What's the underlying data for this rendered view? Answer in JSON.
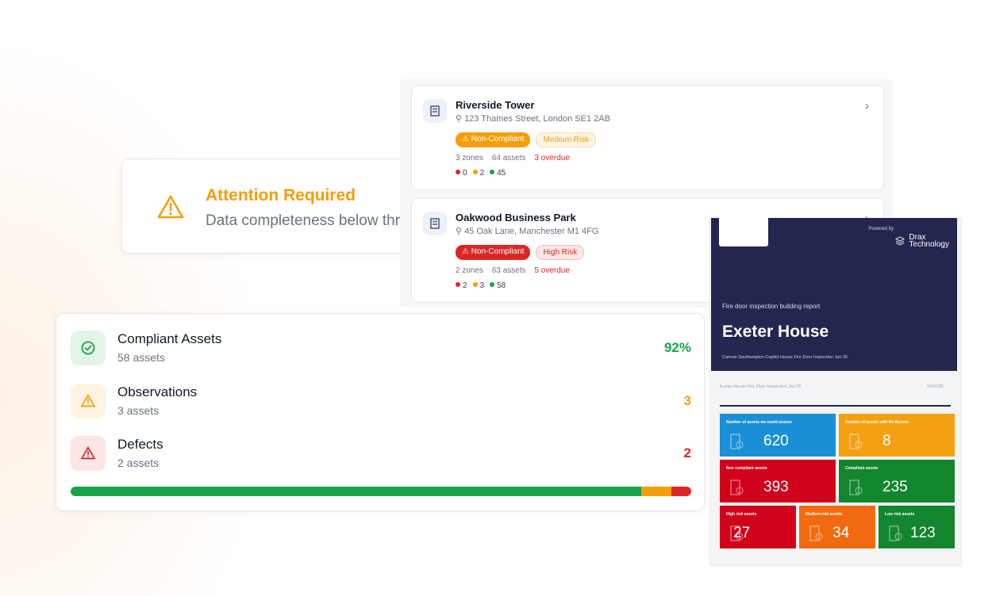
{
  "attention": {
    "title": "Attention Required",
    "text": "Data completeness below threshold"
  },
  "properties": [
    {
      "name": "Riverside Tower",
      "address": "123 Thames Street, London SE1 2AB",
      "compliance_label": "Non-Compliant",
      "compliance_color": "#f59e0b",
      "risk_label": "Medium Risk",
      "zones": "3 zones",
      "assets": "64 assets",
      "overdue": "3 overdue",
      "counts": {
        "red": "0",
        "amber": "2",
        "green": "45"
      }
    },
    {
      "name": "Oakwood Business Park",
      "address": "45 Oak Lane, Manchester M1 4FG",
      "compliance_label": "Non-Compliant",
      "compliance_color": "#dc2626",
      "risk_label": "High Risk",
      "zones": "2 zones",
      "assets": "63 assets",
      "overdue": "5 overdue",
      "counts": {
        "red": "2",
        "amber": "3",
        "green": "58"
      }
    }
  ],
  "asset_status": {
    "rows": [
      {
        "title": "Compliant Assets",
        "subtitle": "58 assets",
        "value": "92%",
        "color": "#16a34a",
        "icon": "check-circle-icon"
      },
      {
        "title": "Observations",
        "subtitle": "3 assets",
        "value": "3",
        "color": "#f59e0b",
        "icon": "warning-icon"
      },
      {
        "title": "Defects",
        "subtitle": "2 assets",
        "value": "2",
        "color": "#dc2626",
        "icon": "alert-triangle-icon"
      }
    ],
    "bar": [
      {
        "name": "compliant",
        "fraction": 0.92,
        "color": "#16a34a"
      },
      {
        "name": "observations",
        "fraction": 0.048,
        "color": "#f59e0b"
      },
      {
        "name": "defects",
        "fraction": 0.032,
        "color": "#dc2626"
      }
    ]
  },
  "report": {
    "powered_by": "Powered by",
    "brand_line1": "Drax",
    "brand_line2": "Technology",
    "subtitle": "Fire door inspection building report",
    "title": "Exeter House",
    "description": "Canvas Southampton Capitol House Fire Door Inspection Jan 26",
    "doc_line": "Exeter House Fire Door Inspection Jan 26",
    "doc_date": "15/01/26",
    "tiles": [
      {
        "label": "Number of assets we could assess",
        "value": "620",
        "color": "#1a8fd6"
      },
      {
        "label": "Number of assets with No Access",
        "value": "8",
        "color": "#f5a012"
      },
      {
        "label": "Non compliant assets",
        "value": "393",
        "color": "#d0021b"
      },
      {
        "label": "Compliant assets",
        "value": "235",
        "color": "#12852f"
      },
      {
        "label": "High risk assets",
        "value": "27",
        "color": "#d0021b"
      },
      {
        "label": "Medium risk assets",
        "value": "34",
        "color": "#f26a0f"
      },
      {
        "label": "Low risk assets",
        "value": "123",
        "color": "#12852f"
      }
    ]
  }
}
